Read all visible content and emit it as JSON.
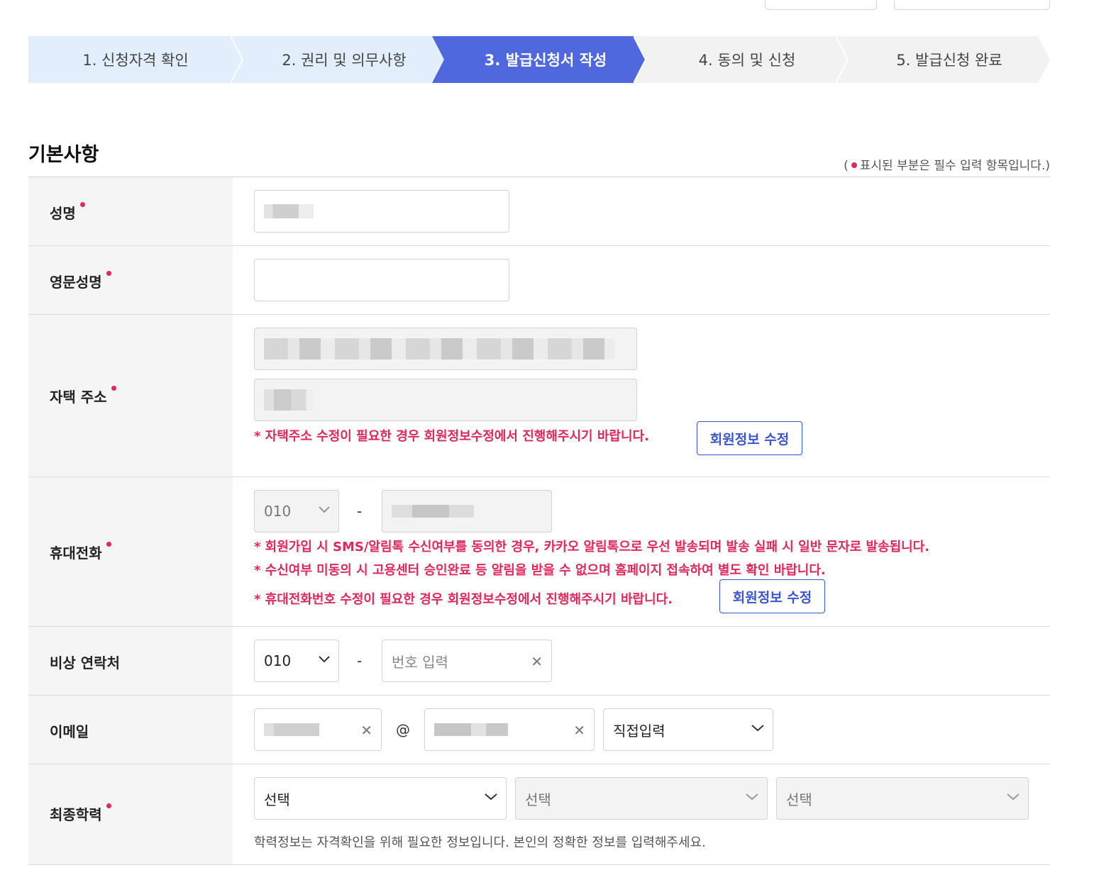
{
  "steps": [
    {
      "label": "1. 신청자격 확인",
      "state": "done"
    },
    {
      "label": "2. 권리 및 의무사항",
      "state": "done"
    },
    {
      "label": "3. 발급신청서 작성",
      "state": "active"
    },
    {
      "label": "4. 동의 및 신청",
      "state": "todo"
    },
    {
      "label": "5. 발급신청 완료",
      "state": "todo"
    }
  ],
  "colors": {
    "active_step": "#4f68de",
    "done_step": "#e3eefc",
    "todo_step": "#f2f2f2",
    "required": "#e0285a",
    "edit_button": "#3b55d0"
  },
  "section": {
    "title": "기본사항",
    "required_note_prefix": "(",
    "required_note_text": "표시된 부분은 필수 입력 항목입니다.)"
  },
  "rows": {
    "name": {
      "label": "성명"
    },
    "english_name": {
      "label": "영문성명",
      "value": ""
    },
    "address": {
      "label": "자택 주소",
      "notice": "* 자택주소 수정이 필요한 경우 회원정보수정에서 진행해주시기 바랍니다.",
      "edit_button": "회원정보 수정"
    },
    "mobile": {
      "label": "휴대전화",
      "prefix": "010",
      "dash": "-",
      "notices": [
        "* 회원가입 시 SMS/알림톡 수신여부를 동의한 경우, 카카오 알림톡으로 우선 발송되며 발송 실패 시 일반 문자로 발송됩니다.",
        "* 수신여부 미동의 시 고용센터 승인완료 등 알림을 받을 수 없으며 홈페이지 접속하여 별도 확인 바랍니다.",
        "* 휴대전화번호 수정이 필요한 경우 회원정보수정에서 진행해주시기 바랍니다."
      ],
      "edit_button": "회원정보 수정"
    },
    "emergency": {
      "label": "비상 연락처",
      "prefix": "010",
      "dash": "-",
      "placeholder": "번호 입력",
      "clear": "✕"
    },
    "email": {
      "label": "이메일",
      "at": "@",
      "domain_select": "직접입력",
      "clear": "✕"
    },
    "education": {
      "label": "최종학력",
      "selects": [
        "선택",
        "선택",
        "선택"
      ],
      "help": "학력정보는 자격확인을 위해 필요한 정보입니다. 본인의 정확한 정보를 입력해주세요."
    }
  }
}
